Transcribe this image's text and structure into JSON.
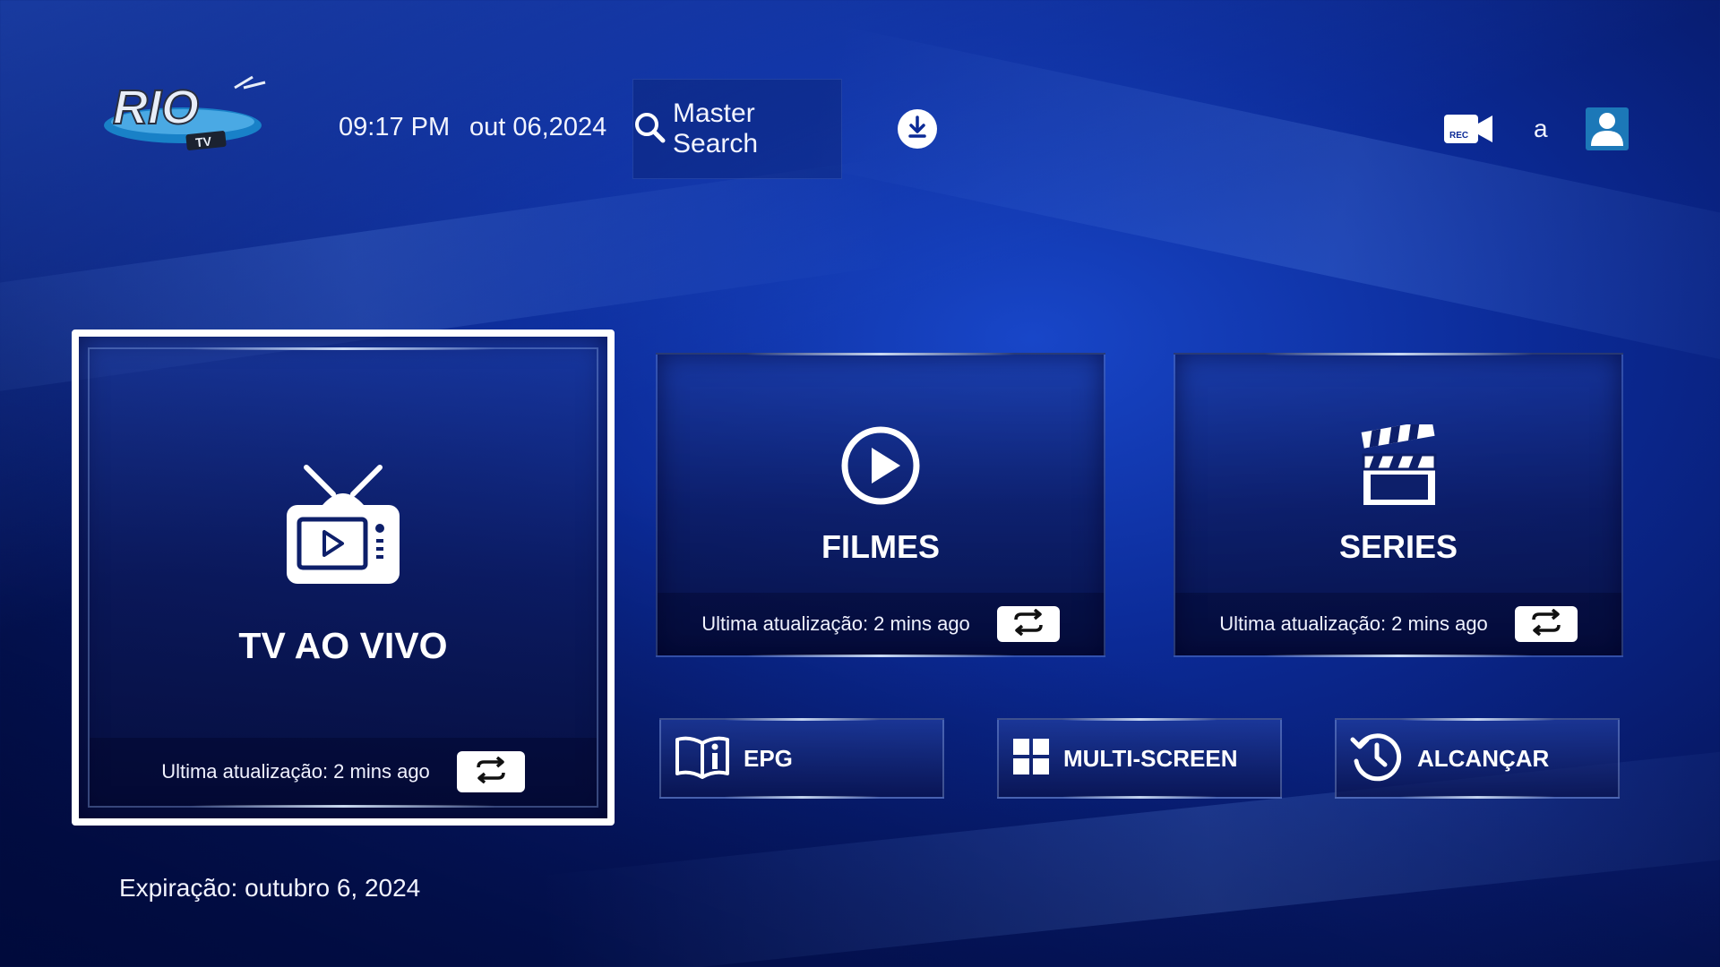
{
  "header": {
    "logo_text": "RIO",
    "logo_sub": "TV",
    "time": "09:17 PM",
    "date": "out 06,2024",
    "search_label": "Master Search",
    "search_icon": "search-icon",
    "download_icon": "download-icon",
    "rec_label": "REC",
    "username": "a",
    "avatar_icon": "user-icon"
  },
  "cards": {
    "live": {
      "title": "TV AO VIVO",
      "icon": "tv-icon",
      "update_text": "Ultima atualização: 2 mins ago"
    },
    "films": {
      "title": "FILMES",
      "icon": "play-circle-icon",
      "update_text": "Ultima atualização: 2 mins ago"
    },
    "series": {
      "title": "SERIES",
      "icon": "clapperboard-icon",
      "update_text": "Ultima atualização: 2 mins ago"
    }
  },
  "buttons": {
    "epg": "EPG",
    "multiscreen": "MULTI-SCREEN",
    "catchup": "ALCANÇAR"
  },
  "footer": {
    "expiry": "Expiração: outubro 6, 2024"
  },
  "colors": {
    "accent": "#ffffff",
    "background": "#0b2a96",
    "avatar_bg": "#1c78b8"
  }
}
